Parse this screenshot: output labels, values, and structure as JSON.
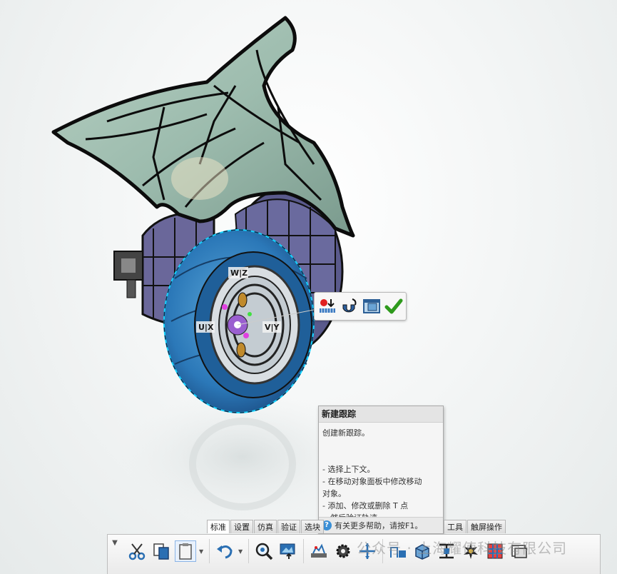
{
  "viewport": {
    "triad_labels": {
      "w": "W|Z",
      "u": "U|X",
      "v": "V|Y"
    }
  },
  "context_toolbar": {
    "buttons": [
      {
        "icon": "add-point-icon"
      },
      {
        "icon": "snap-magnet-icon"
      },
      {
        "icon": "view-object-icon"
      },
      {
        "icon": "confirm-check-icon"
      }
    ],
    "colors": {
      "confirm": "#2e9a1c"
    }
  },
  "tooltip": {
    "title": "新建跟踪",
    "description": "创建新跟踪。",
    "lines": [
      "- 选择上下文。",
      "- 在移动对象面板中修改移动",
      "对象。",
      "- 添加、修改或删除 T 点",
      "，然后验证轨迹。"
    ],
    "help": "有关更多帮助，请按F1。"
  },
  "tabs": {
    "left": [
      {
        "label": "标准",
        "active": true
      },
      {
        "label": "设置",
        "active": false
      },
      {
        "label": "仿真",
        "active": false
      },
      {
        "label": "验证",
        "active": false
      },
      {
        "label": "选块",
        "active": false
      }
    ],
    "right": [
      {
        "label": "工具",
        "active": false
      },
      {
        "label": "触屏操作",
        "active": false
      }
    ]
  },
  "toolbar": {
    "buttons": [
      {
        "icon": "cut-scissors-icon"
      },
      {
        "icon": "copy-icon"
      },
      {
        "icon": "paste-icon"
      },
      {
        "icon": "undo-icon"
      },
      {
        "icon": "zoom-icon"
      },
      {
        "icon": "capture-icon"
      },
      {
        "icon": "new-track-icon"
      },
      {
        "icon": "gear-settings-icon"
      },
      {
        "icon": "move-compass-icon"
      },
      {
        "icon": "track-path-icon"
      },
      {
        "icon": "box-view-icon"
      },
      {
        "icon": "measure-icon"
      },
      {
        "icon": "clash-icon"
      },
      {
        "icon": "grid-icon"
      },
      {
        "icon": "render-icon"
      }
    ]
  },
  "watermark": "公众号 · 上海耀俥科技有限公司"
}
